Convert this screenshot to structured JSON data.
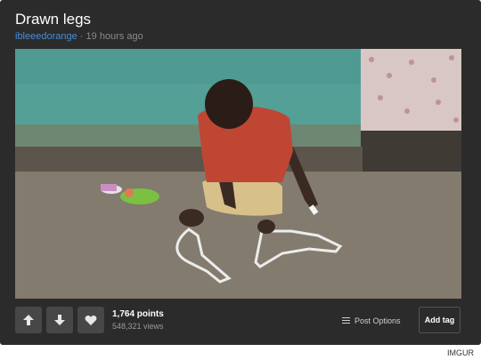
{
  "post": {
    "title": "Drawn legs",
    "username": "ibleeedorange",
    "separator": "·",
    "time": "19 hours ago"
  },
  "actions": {
    "upvote_icon": "arrow-up-icon",
    "downvote_icon": "arrow-down-icon",
    "favorite_icon": "heart-icon",
    "points": "1,764 points",
    "views": "548,321 views",
    "post_options": "Post Options",
    "add_tag": "Add tag"
  },
  "credit": "IMGUR",
  "colors": {
    "card_bg": "#2b2b2b",
    "username": "#4b8cd6",
    "button_bg": "#474747"
  }
}
